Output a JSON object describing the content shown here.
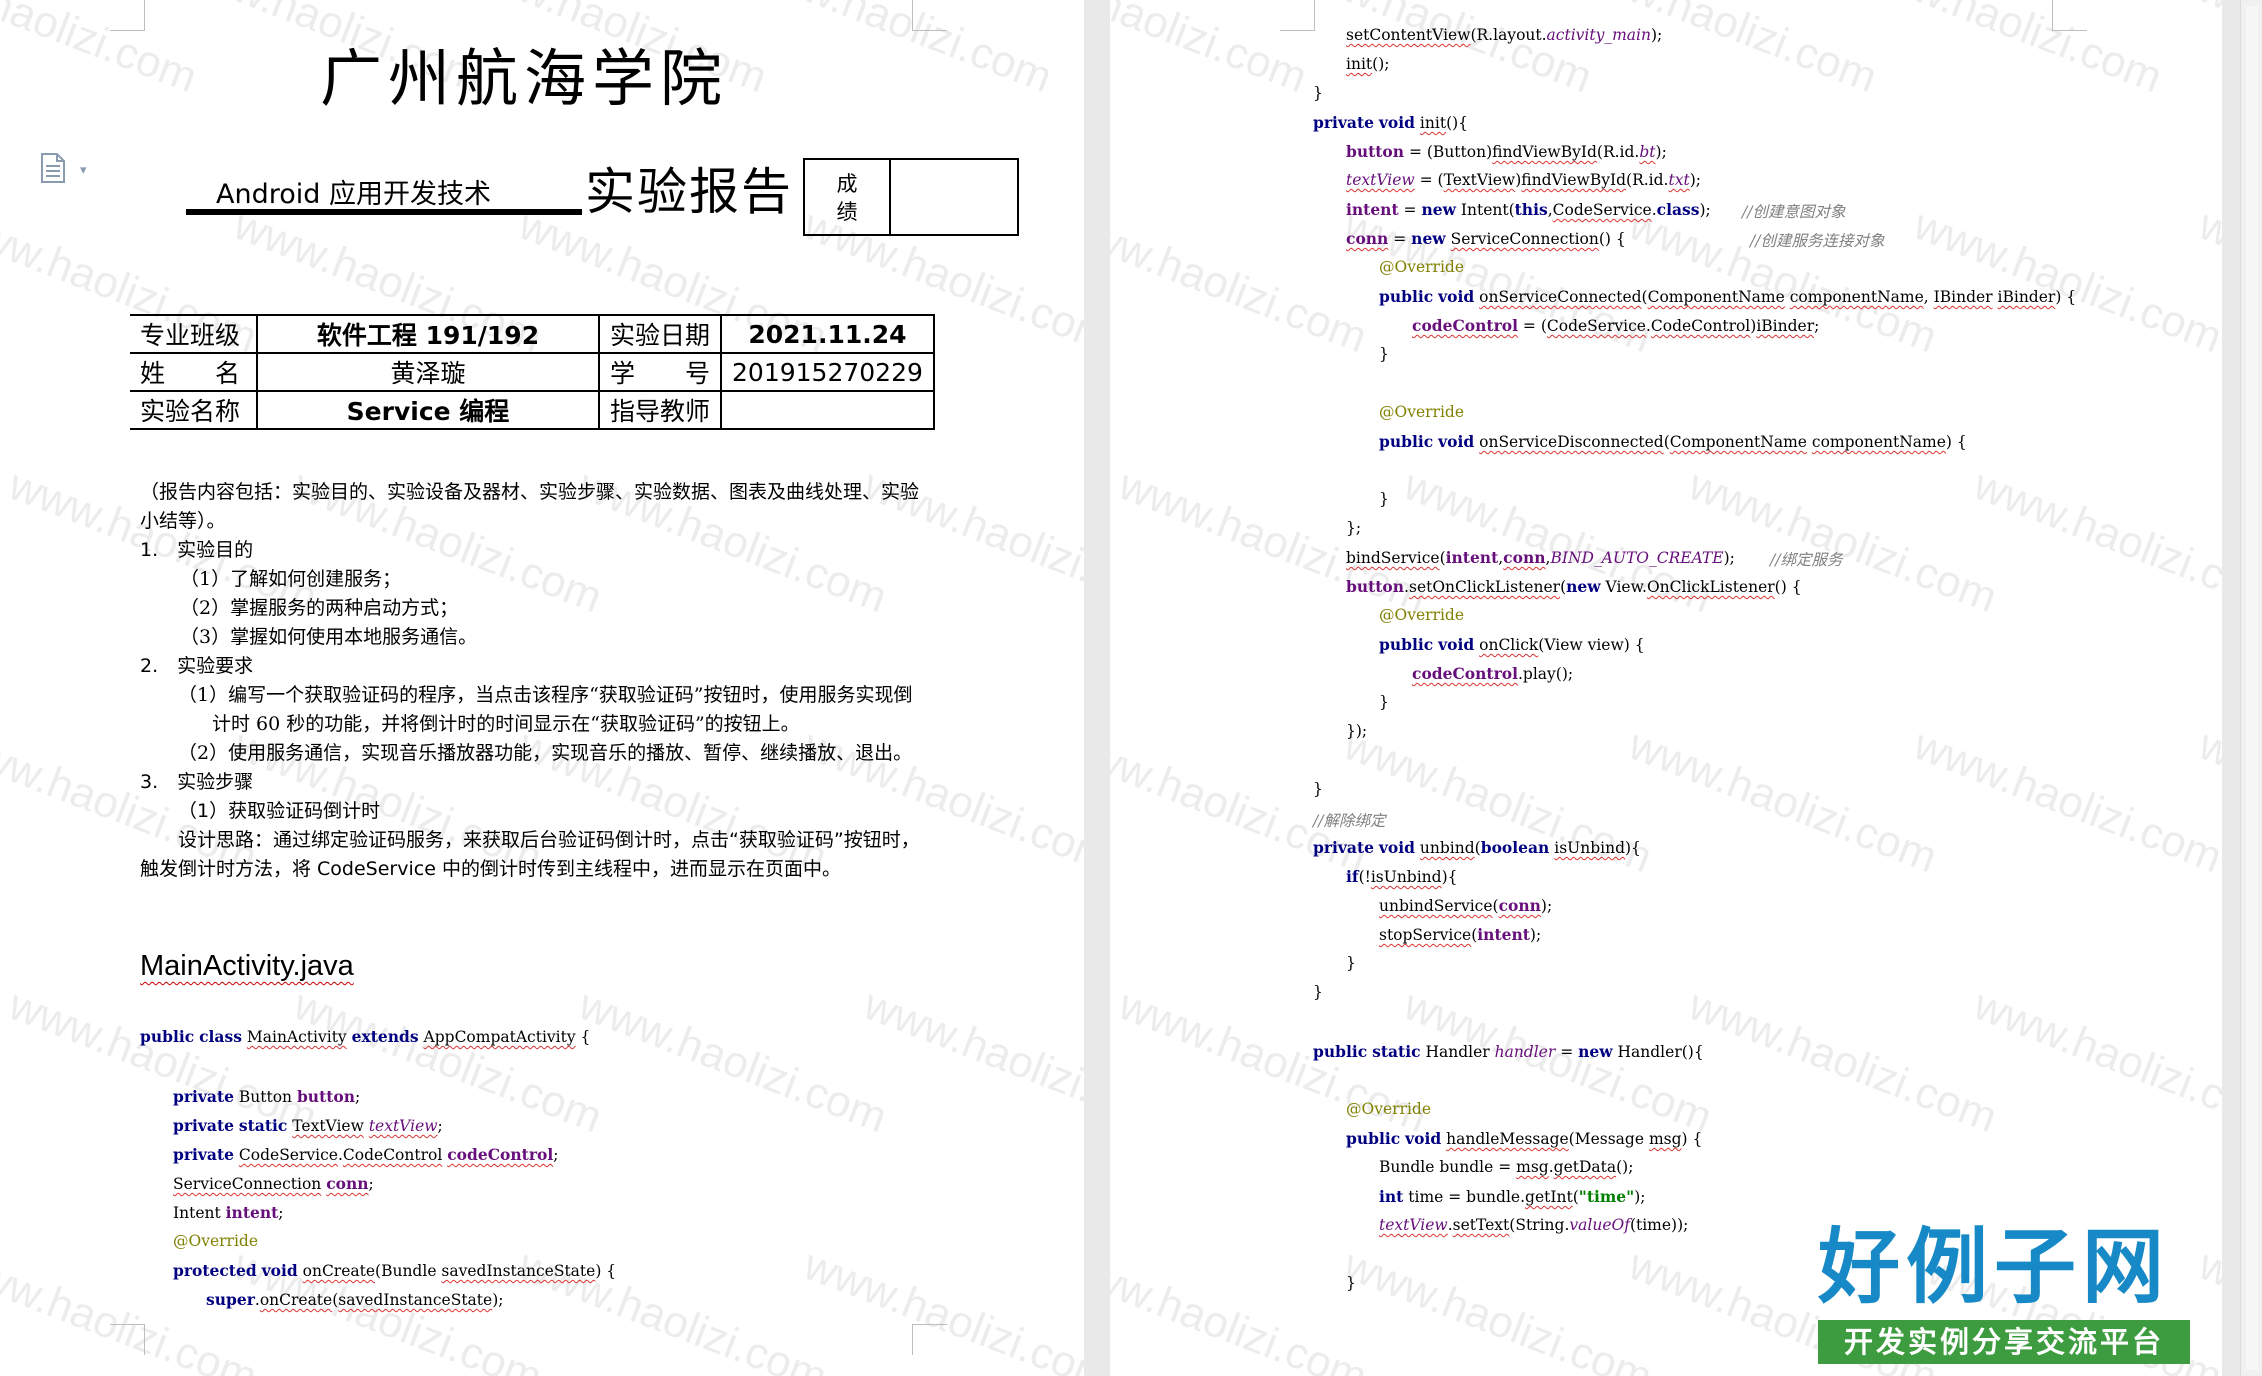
{
  "watermark": "www.haolizi.com",
  "header": {
    "school": "广州航海学院",
    "course": "Android 应用开发技术",
    "report_title": "实验报告",
    "score_label_1": "成",
    "score_label_2": "绩"
  },
  "info": {
    "class_label": "专业班级",
    "class_value": "软件工程 191/192",
    "date_label": "实验日期",
    "date_value": "2021.11.24",
    "name_label": "姓　　名",
    "name_value": "黄泽璇",
    "id_label": "学　　号",
    "id_value": "201915270229",
    "exp_label": "实验名称",
    "exp_value": "Service 编程",
    "teacher_label": "指导教师",
    "teacher_value": ""
  },
  "body": {
    "intro": "（报告内容包括：实验目的、实验设备及器材、实验步骤、实验数据、图表及曲线处理、实验小结等）。",
    "s1": "1.　实验目的",
    "s1_1": "（1）了解如何创建服务；",
    "s1_2": "（2）掌握服务的两种启动方式；",
    "s1_3": "（3）掌握如何使用本地服务通信。",
    "s2": "2.　实验要求",
    "s2_1": "（1）编写一个获取验证码的程序，当点击该程序“获取验证码”按钮时，使用服务实现倒计时 60 秒的功能，并将倒计时的时间显示在“获取验证码”的按钮上。",
    "s2_2": "（2）使用服务通信，实现音乐播放器功能，实现音乐的播放、暂停、继续播放、退出。",
    "s3": "3.　实验步骤",
    "s3_1": "（1）获取验证码倒计时",
    "design": "设计思路：通过绑定验证码服务，来获取后台验证码倒计时，点击“获取验证码”按钮时，触发倒计时方法，将 CodeService 中的倒计时传到主线程中，进而显示在页面中。",
    "file_title": "MainActivity.java"
  },
  "code_left": [
    "public class MainActivity extends AppCompatActivity {",
    "private Button button;",
    "private static TextView textView;",
    "private CodeService.CodeControl codeControl;",
    "ServiceConnection conn;",
    "Intent intent;",
    "@Override",
    "protected void onCreate(Bundle savedInstanceState) {",
    "super.onCreate(savedInstanceState);"
  ],
  "code_right": [
    "setContentView(R.layout.activity_main);",
    "init();",
    "}",
    "private void init(){",
    "button = (Button)findViewById(R.id.bt);",
    "textView = (TextView)findViewById(R.id.txt);",
    "intent = new Intent(this,CodeService.class);",
    "//创建意图对象",
    "conn = new ServiceConnection() {",
    "//创建服务连接对象",
    "@Override",
    "public void onServiceConnected(ComponentName componentName, IBinder iBinder) {",
    "codeControl = (CodeService.CodeControl)iBinder;",
    "}",
    "@Override",
    "public void onServiceDisconnected(ComponentName componentName) {",
    "}",
    "};",
    "bindService(intent,conn,BIND_AUTO_CREATE);",
    "//绑定服务",
    "button.setOnClickListener(new View.OnClickListener() {",
    "@Override",
    "public void onClick(View view) {",
    "codeControl.play();",
    "}",
    "});",
    "}",
    "//解除绑定",
    "private void unbind(boolean isUnbind){",
    "if(!isUnbind){",
    "unbindService(conn);",
    "stopService(intent);",
    "}",
    "}",
    "public static Handler handler = new Handler(){",
    "@Override",
    "public void handleMessage(Message msg) {",
    "Bundle bundle = msg.getData();",
    "int time = bundle.getInt(\"time\");",
    "textView.setText(String.valueOf(time));",
    "}"
  ],
  "stamp": {
    "title": "好例子网",
    "subtitle": "开发实例分享交流平台"
  },
  "colors": {
    "keyword": "#000080",
    "field": "#660e7a",
    "comment": "#808080",
    "annotation": "#808000",
    "string": "#008000",
    "stamp_blue": "#1689c6",
    "stamp_green": "#3d9c3f"
  }
}
